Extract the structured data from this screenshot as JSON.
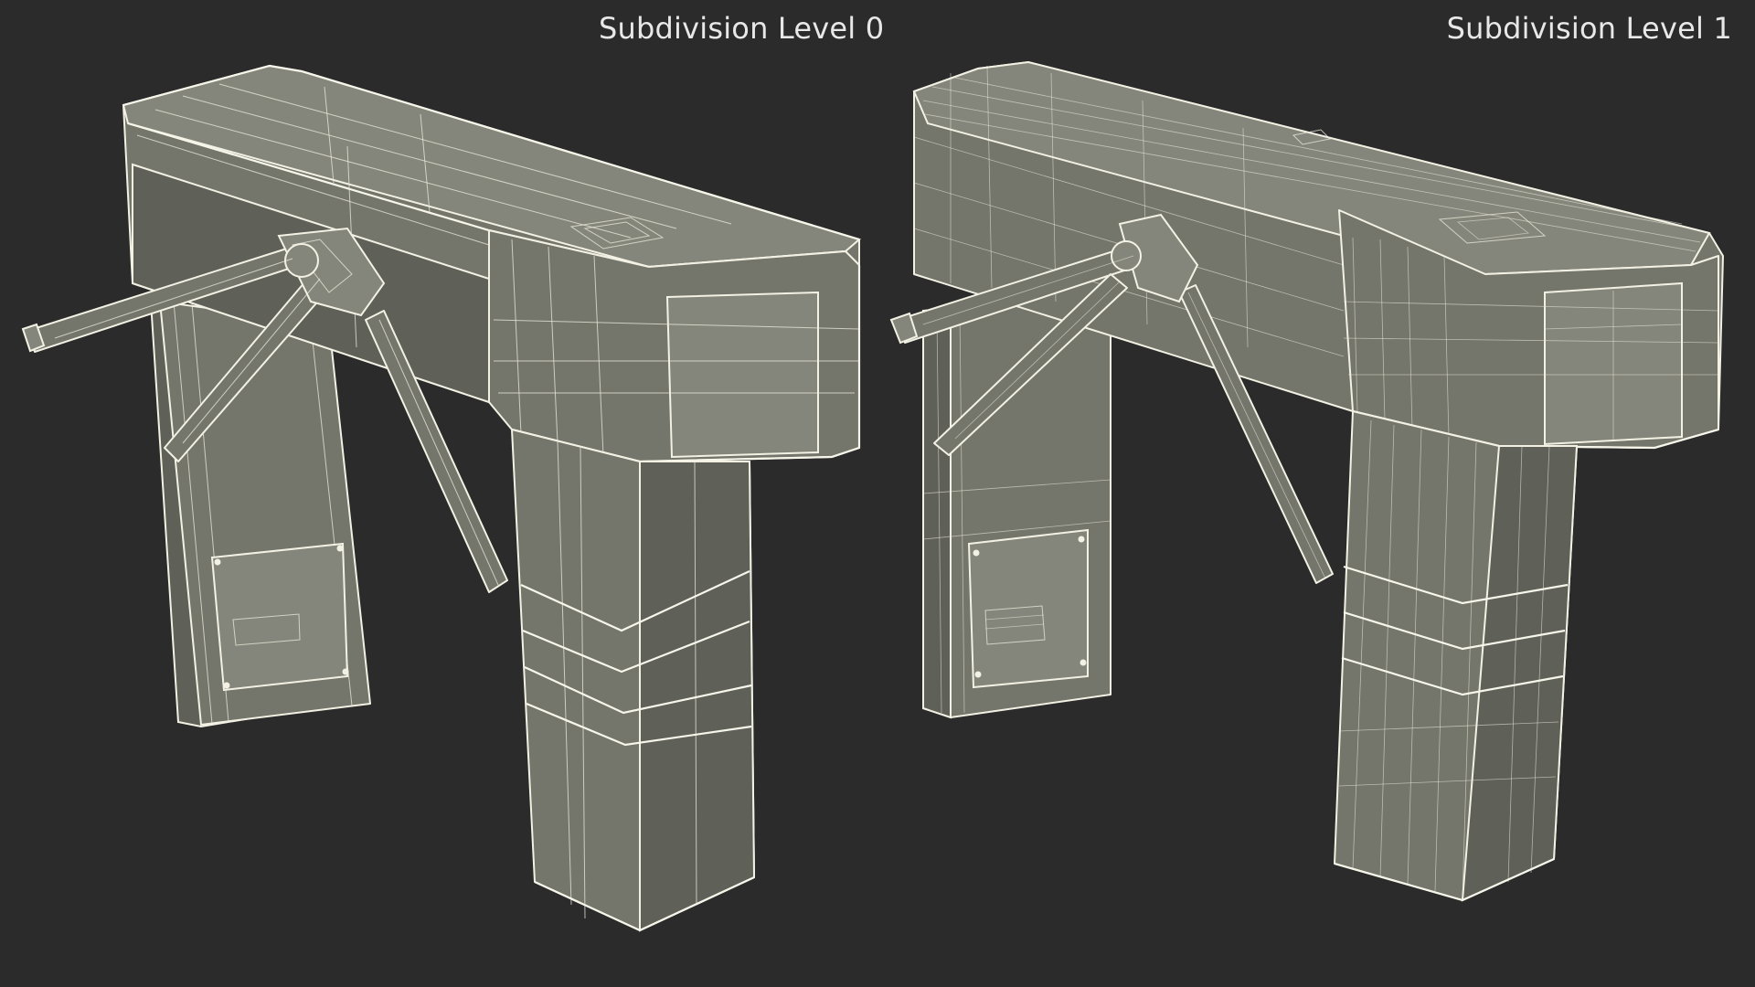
{
  "labels": {
    "left": "Subdivision Level 0",
    "right": "Subdivision Level 1"
  },
  "colors": {
    "background": "#2b2b2b",
    "model_fill": "#74756b",
    "wireframe": "#f2f1e4",
    "label_text": "#e8e8e8"
  },
  "scene": {
    "left_model": "tripod-turnstile-wireframe-low",
    "right_model": "tripod-turnstile-wireframe-subdivided"
  }
}
